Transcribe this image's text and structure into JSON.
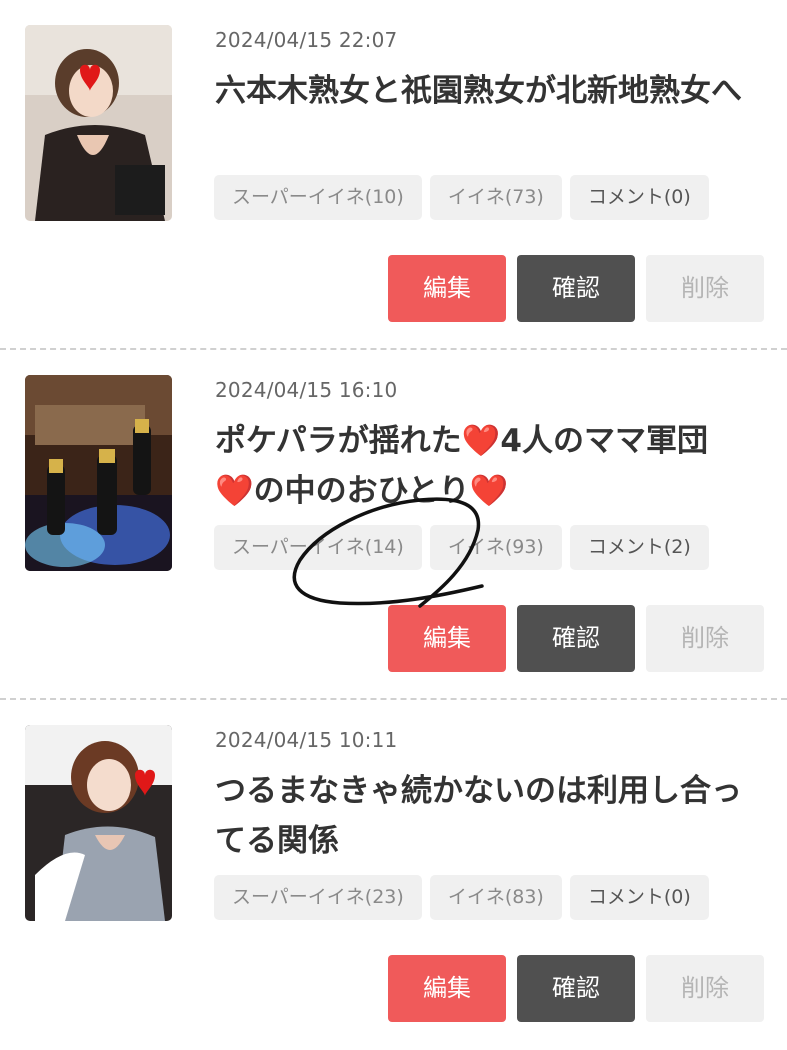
{
  "posts": [
    {
      "date": "2024/04/15 22:07",
      "title": "六本木熟女と祇園熟女が北新地熟女へ",
      "chips": {
        "super_like": "スーパーイイネ(10)",
        "like": "イイネ(73)",
        "comment": "コメント(0)"
      }
    },
    {
      "date": "2024/04/15 16:10",
      "title_parts": [
        "ポケパラが揺れた",
        "4人のママ軍団",
        "の中のおひとり"
      ],
      "heart_glyph": "❤️",
      "chips": {
        "super_like": "スーパーイイネ(14)",
        "like": "イイネ(93)",
        "comment": "コメント(2)"
      }
    },
    {
      "date": "2024/04/15 10:11",
      "title": "つるまなきゃ続かないのは利用し合ってる関係",
      "chips": {
        "super_like": "スーパーイイネ(23)",
        "like": "イイネ(83)",
        "comment": "コメント(0)"
      }
    }
  ],
  "actions": {
    "edit": "編集",
    "confirm": "確認",
    "delete": "削除"
  },
  "colors": {
    "edit_button": "#f05a5a",
    "confirm_button": "#505050",
    "delete_button": "#f0f0f0",
    "chip_background": "#f0f0f0",
    "heart": "#d81b1b"
  }
}
